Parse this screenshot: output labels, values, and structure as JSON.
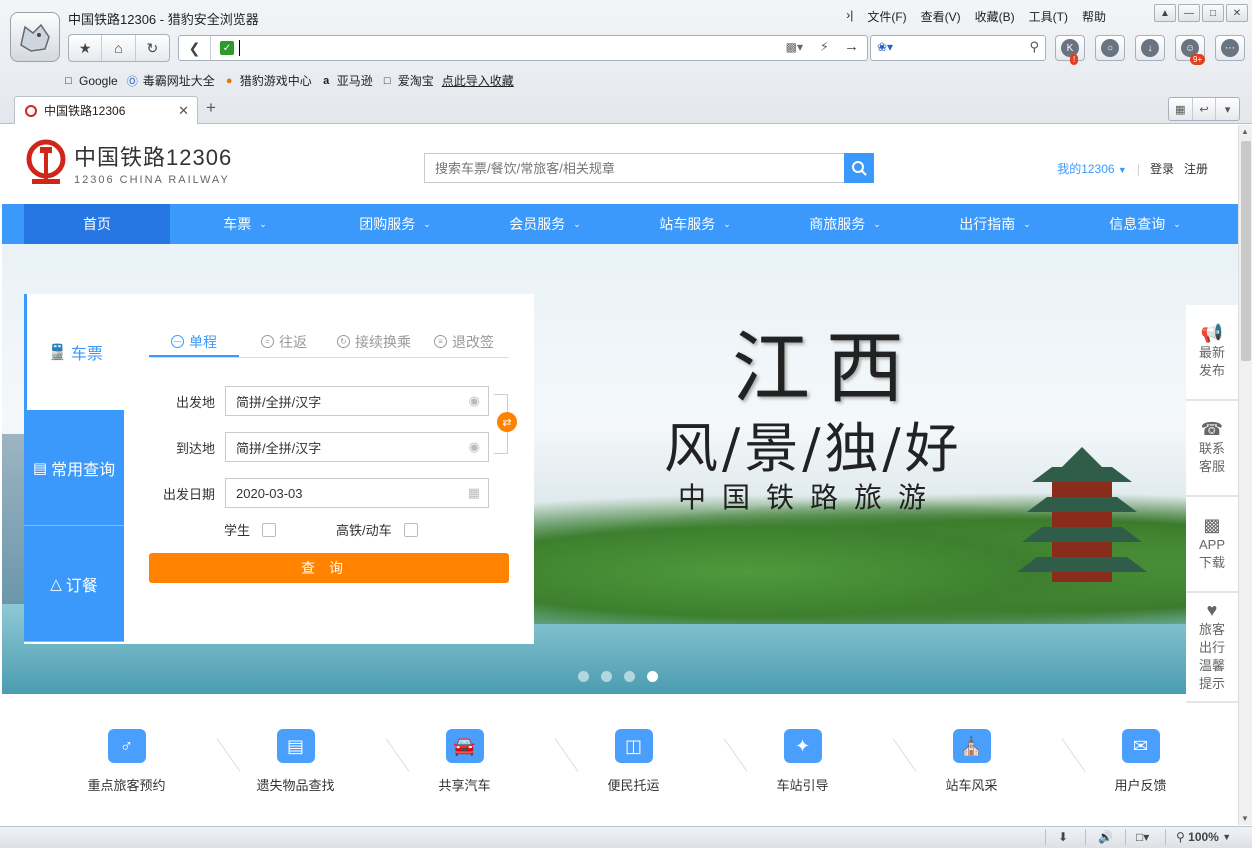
{
  "browser": {
    "window_title": "中国铁路12306 - 猎豹安全浏览器",
    "menu": [
      "文件(F)",
      "查看(V)",
      "收藏(B)",
      "工具(T)",
      "帮助"
    ],
    "address_value": "",
    "bookmarks": [
      "Google",
      "毒霸网址大全",
      "猎豹游戏中心",
      "亚马逊",
      "爱淘宝",
      "点此导入收藏"
    ],
    "tab_title": "中国铁路12306",
    "new_tab": "+",
    "badge_k": "!",
    "badge_games": "9+",
    "zoom": "100%"
  },
  "site": {
    "logo_cn": "中国铁路12306",
    "logo_en": "12306 CHINA RAILWAY",
    "search_placeholder": "搜索车票/餐饮/常旅客/相关规章",
    "my12306": "我的12306",
    "login": "登录",
    "register": "注册"
  },
  "nav": [
    "首页",
    "车票",
    "团购服务",
    "会员服务",
    "站车服务",
    "商旅服务",
    "出行指南",
    "信息查询"
  ],
  "banner": {
    "title": "江西",
    "subtitle": "风/景/独/好",
    "tagline": "中国铁路旅游",
    "slides": 4,
    "active_slide": 4
  },
  "booking": {
    "side_tabs": [
      "车票",
      "常用查询",
      "订餐"
    ],
    "trip_tabs": [
      "单程",
      "往返",
      "接续换乘",
      "退改签"
    ],
    "from_label": "出发地",
    "from_placeholder": "简拼/全拼/汉字",
    "to_label": "到达地",
    "to_placeholder": "简拼/全拼/汉字",
    "date_label": "出发日期",
    "date_value": "2020-03-03",
    "student_label": "学生",
    "highspeed_label": "高铁/动车",
    "query_button": "查询"
  },
  "float_bar": [
    {
      "icon": "megaphone-icon",
      "label": "最新发布"
    },
    {
      "icon": "phone-icon",
      "label": "联系客服"
    },
    {
      "icon": "qr-code-icon",
      "label": "APP下载"
    },
    {
      "icon": "heart-hand-icon",
      "label": "旅客出行温馨提示"
    }
  ],
  "services": [
    "重点旅客预约",
    "遗失物品查找",
    "共享汽车",
    "便民托运",
    "车站引导",
    "站车风采",
    "用户反馈"
  ],
  "colors": {
    "primary": "#3b99fc",
    "active_nav": "#2676e3",
    "orange": "#ff8200"
  }
}
